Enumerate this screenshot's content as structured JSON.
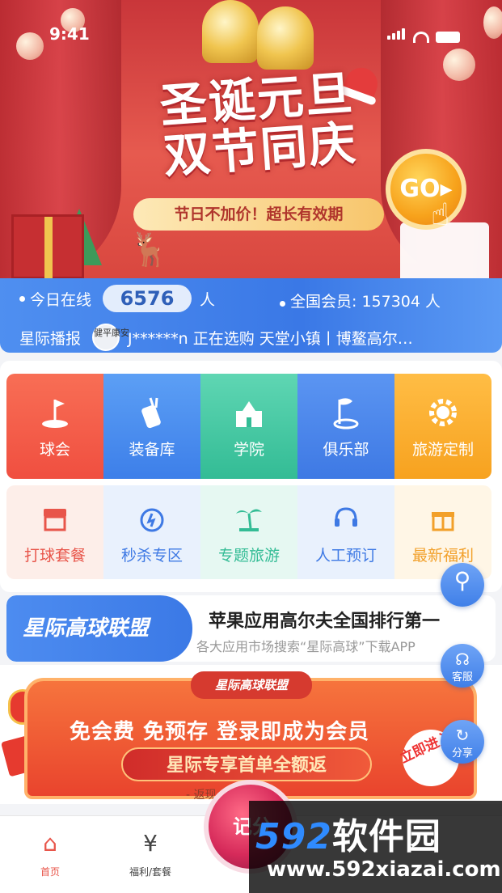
{
  "status_bar": {
    "time": "9:41"
  },
  "banner": {
    "headline_line1": "圣诞元旦",
    "headline_line2": "双节同庆",
    "subtitle": "节日不加价！超长有效期",
    "go_label": "GO"
  },
  "stats": {
    "online_label": "今日在线",
    "online_count": "6576",
    "online_unit": "人",
    "members_text": "全国会员: 157304 人",
    "broadcast_label": "星际播报",
    "broadcast_avatar_text": "健平康安",
    "broadcast_text": "J******n 正在选购 天堂小镇丨博鳌高尔…"
  },
  "grid": {
    "row1": [
      {
        "label": "球会",
        "icon": "golf-flag-icon"
      },
      {
        "label": "装备库",
        "icon": "golf-bag-icon"
      },
      {
        "label": "学院",
        "icon": "academy-icon"
      },
      {
        "label": "俱乐部",
        "icon": "flag-icon"
      },
      {
        "label": "旅游定制",
        "icon": "gear-icon"
      }
    ],
    "row2": [
      {
        "label": "打球套餐",
        "icon": "shop-icon"
      },
      {
        "label": "秒杀专区",
        "icon": "alarm-icon"
      },
      {
        "label": "专题旅游",
        "icon": "palm-icon"
      },
      {
        "label": "人工预订",
        "icon": "headset-icon"
      },
      {
        "label": "最新福利",
        "icon": "gift-icon"
      }
    ]
  },
  "alliance": {
    "logo_text": "星际高球联盟",
    "title": "苹果应用高尔夫全国排行第一",
    "subtitle": "各大应用市场搜索“星际高球”下载APP"
  },
  "promo": {
    "top_tag": "星际高球联盟",
    "line1": "免会费 免预存 登录即成为会员",
    "line2": "星际专享首单全额返",
    "line3": "- 返现… 万元 -",
    "enter_label": "立即进入"
  },
  "floating": {
    "service_label": "客服",
    "share_label": "分享"
  },
  "nav": {
    "home_label": "首页",
    "welfare_label": "福利/套餐",
    "record_label": "记分"
  },
  "watermark": {
    "brand_num": "592",
    "brand_text": "软件园",
    "url": "www.592xiazai.com"
  },
  "colors": {
    "primary_blue": "#3d7fe9",
    "accent_red": "#e8554a",
    "accent_green": "#33bc95",
    "accent_orange": "#f7a21f"
  }
}
